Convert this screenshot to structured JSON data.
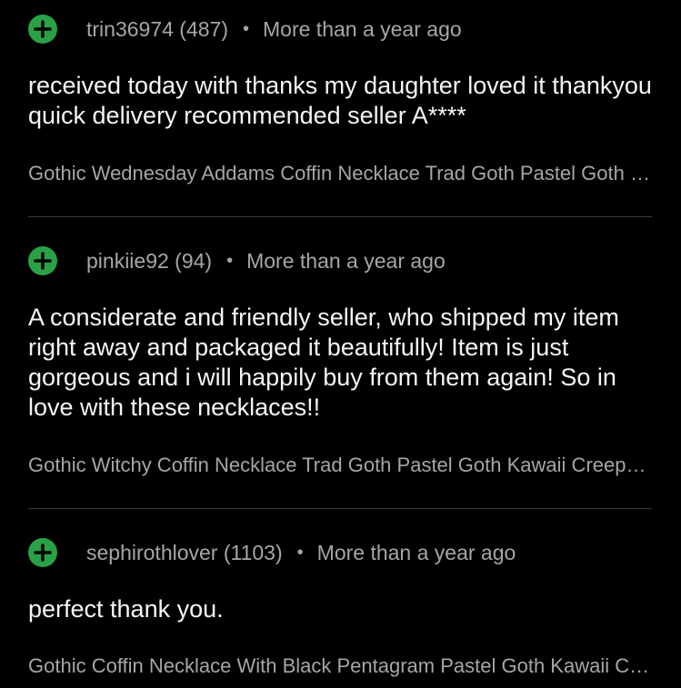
{
  "accent_color": "#2aa147",
  "reviews": [
    {
      "rating_icon": "plus-circle-icon",
      "user": "trin36974 (487)",
      "separator": "•",
      "time": "More than a year ago",
      "text": "received today with thanks my daughter loved it thankyou quick delivery recommended seller A****",
      "item": "Gothic Wednesday Addams Coffin Necklace Trad Goth Pastel Goth Kawaii Creepy Cute"
    },
    {
      "rating_icon": "plus-circle-icon",
      "user": "pinkiie92 (94)",
      "separator": "•",
      "time": "More than a year ago",
      "text": "A considerate and friendly seller, who shipped my item right away and packaged it beautifully! Item is just gorgeous and i will happily buy from them again! So in love with these necklaces!!",
      "item": "Gothic Witchy Coffin Necklace Trad Goth Pastel Goth Kawaii Creepy Cute"
    },
    {
      "rating_icon": "plus-circle-icon",
      "user": "sephirothlover (1103)",
      "separator": "•",
      "time": "More than a year ago",
      "text": "perfect thank you.",
      "item": "Gothic Coffin Necklace With Black Pentagram Pastel Goth Kawaii Creepy Cute"
    }
  ]
}
